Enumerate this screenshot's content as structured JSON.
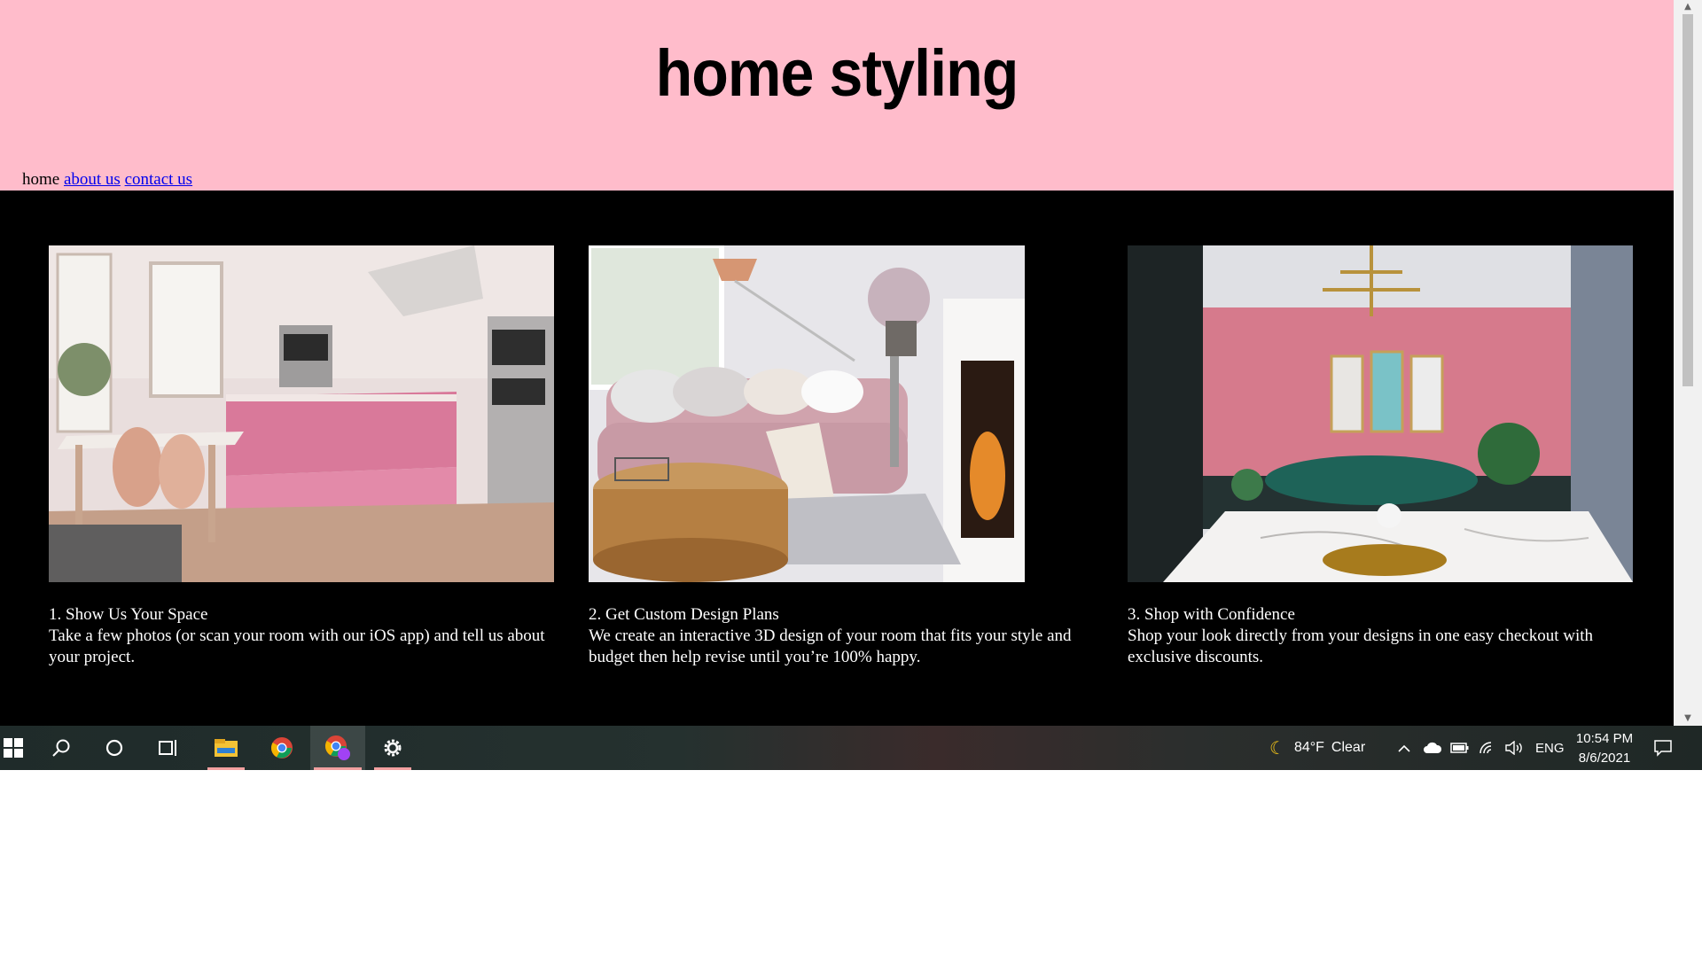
{
  "site": {
    "title": "home styling",
    "nav": {
      "current": "home",
      "links": [
        "about us",
        "contact us"
      ]
    },
    "cards": [
      {
        "title": "1. Show Us Your Space",
        "text": "Take a few photos (or scan your room with our iOS app) and tell us about your project.",
        "image": "pink-kitchen-photo"
      },
      {
        "title": "2. Get Custom Design Plans",
        "text": "We create an interactive 3D design of your room that fits your style and budget then help revise until you’re 100% happy.",
        "image": "pink-living-room-photo"
      },
      {
        "title": "3. Shop with Confidence",
        "text": "Shop your look directly from your designs in one easy checkout with exclusive discounts.",
        "image": "pink-dining-room-photo"
      }
    ]
  },
  "colors": {
    "header_bg": "#ffbccb",
    "page_bg": "#000000",
    "link": "#0000ee"
  },
  "taskbar": {
    "icons": [
      "windows-start-icon",
      "search-icon",
      "cortana-icon",
      "task-view-icon",
      "file-explorer-icon",
      "chrome-icon",
      "chrome-profile-icon",
      "settings-icon"
    ],
    "weather": {
      "temp": "84°F",
      "condition": "Clear"
    },
    "language": "ENG",
    "time": "10:54 PM",
    "date": "8/6/2021"
  }
}
